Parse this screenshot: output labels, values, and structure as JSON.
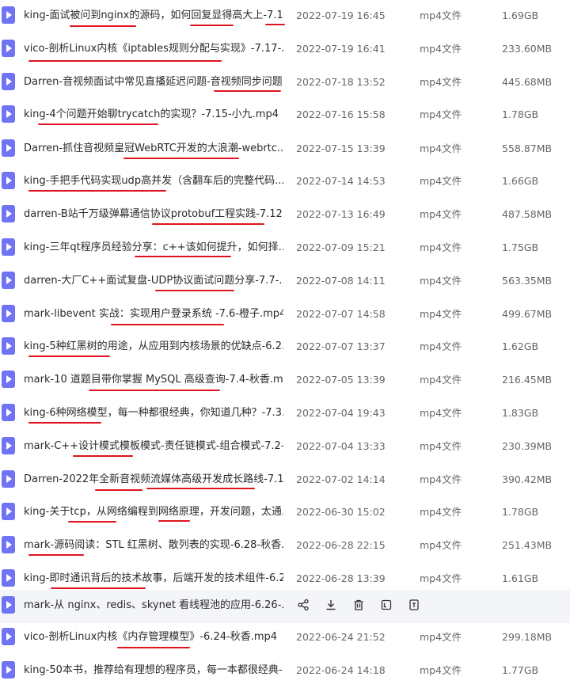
{
  "colors": {
    "accent": "#6f73f4",
    "underline": "#e0141e"
  },
  "file_icon": "video-file-icon",
  "rows": [
    {
      "name": "king-面试被问到nginx的源码，如何回复显得高大上-7.1...",
      "date": "2022-07-19 16:45",
      "type": "mp4文件",
      "size": "1.69GB"
    },
    {
      "name": "vico-剖析Linux内核《iptables规则分配与实现》-7.17-...",
      "date": "2022-07-19 16:41",
      "type": "mp4文件",
      "size": "233.60MB"
    },
    {
      "name": "Darren-音视频面试中常见直播延迟问题-音视频同步问题...",
      "date": "2022-07-18 13:52",
      "type": "mp4文件",
      "size": "445.68MB"
    },
    {
      "name": "king-4个问题开始聊trycatch的实现？-7.15-小九.mp4",
      "date": "2022-07-16 15:58",
      "type": "mp4文件",
      "size": "1.78GB"
    },
    {
      "name": "Darren-抓住音视频皇冠WebRTC开发的大浪潮-webrtc...",
      "date": "2022-07-15 13:39",
      "type": "mp4文件",
      "size": "558.87MB"
    },
    {
      "name": "king-手把手代码实现udp高并发（含翻车后的完整代码...",
      "date": "2022-07-14 14:53",
      "type": "mp4文件",
      "size": "1.66GB"
    },
    {
      "name": "darren-B站千万级弹幕通信协议protobuf工程实践-7.12...",
      "date": "2022-07-13 16:49",
      "type": "mp4文件",
      "size": "487.58MB"
    },
    {
      "name": "king-三年qt程序员经验分享：c++该如何提升，如何择...",
      "date": "2022-07-09 15:21",
      "type": "mp4文件",
      "size": "1.75GB"
    },
    {
      "name": "darren-大厂C++面试复盘-UDP协议面试问题分享-7.7-...",
      "date": "2022-07-08 14:11",
      "type": "mp4文件",
      "size": "563.35MB"
    },
    {
      "name": "mark-libevent 实战：实现用户登录系统 -7.6-橙子.mp4",
      "date": "2022-07-07 14:58",
      "type": "mp4文件",
      "size": "499.67MB"
    },
    {
      "name": "king-5种红黑树的用途，从应用到内核场景的优缺点-6.2...",
      "date": "2022-07-07 13:37",
      "type": "mp4文件",
      "size": "1.62GB"
    },
    {
      "name": "mark-10 道题目带你掌握 MySQL 高级查询-7.4-秋香.m...",
      "date": "2022-07-05 13:39",
      "type": "mp4文件",
      "size": "216.45MB"
    },
    {
      "name": "king-6种网络模型，每一种都很经典，你知道几种？-7.3...",
      "date": "2022-07-04 19:43",
      "type": "mp4文件",
      "size": "1.83GB"
    },
    {
      "name": "mark-C++设计模式模板模式-责任链模式-组合模式-7.2-...",
      "date": "2022-07-04 13:33",
      "type": "mp4文件",
      "size": "230.39MB"
    },
    {
      "name": "Darren-2022年全新音视频流媒体高级开发成长路线-7.1-...",
      "date": "2022-07-02 14:14",
      "type": "mp4文件",
      "size": "390.42MB"
    },
    {
      "name": "king-关于tcp，从网络编程到网络原理，开发问题，太通...",
      "date": "2022-06-30 15:02",
      "type": "mp4文件",
      "size": "1.78GB"
    },
    {
      "name": "mark-源码阅读：STL 红黑树、散列表的实现-6.28-秋香...",
      "date": "2022-06-28 22:15",
      "type": "mp4文件",
      "size": "251.43MB"
    },
    {
      "name": "king-即时通讯背后的技术故事，后端开发的技术组件-6.2...",
      "date": "2022-06-28 13:39",
      "type": "mp4文件",
      "size": "1.61GB"
    },
    {
      "name": "mark-从 nginx、redis、skynet 看线程池的应用-6.26-...",
      "date": "",
      "type": "",
      "size": "",
      "hover": true
    },
    {
      "name": "vico-剖析Linux内核《内存管理模型》-6.24-秋香.mp4",
      "date": "2022-06-24 21:52",
      "type": "mp4文件",
      "size": "299.18MB"
    },
    {
      "name": "king-50本书，推荐给有理想的程序员，每一本都很经典-...",
      "date": "2022-06-24 14:18",
      "type": "mp4文件",
      "size": "1.77GB"
    }
  ],
  "hover_actions": [
    {
      "icon": "share-icon"
    },
    {
      "icon": "download-icon"
    },
    {
      "icon": "delete-icon"
    },
    {
      "icon": "text-extract-icon"
    },
    {
      "icon": "more-icon"
    }
  ]
}
